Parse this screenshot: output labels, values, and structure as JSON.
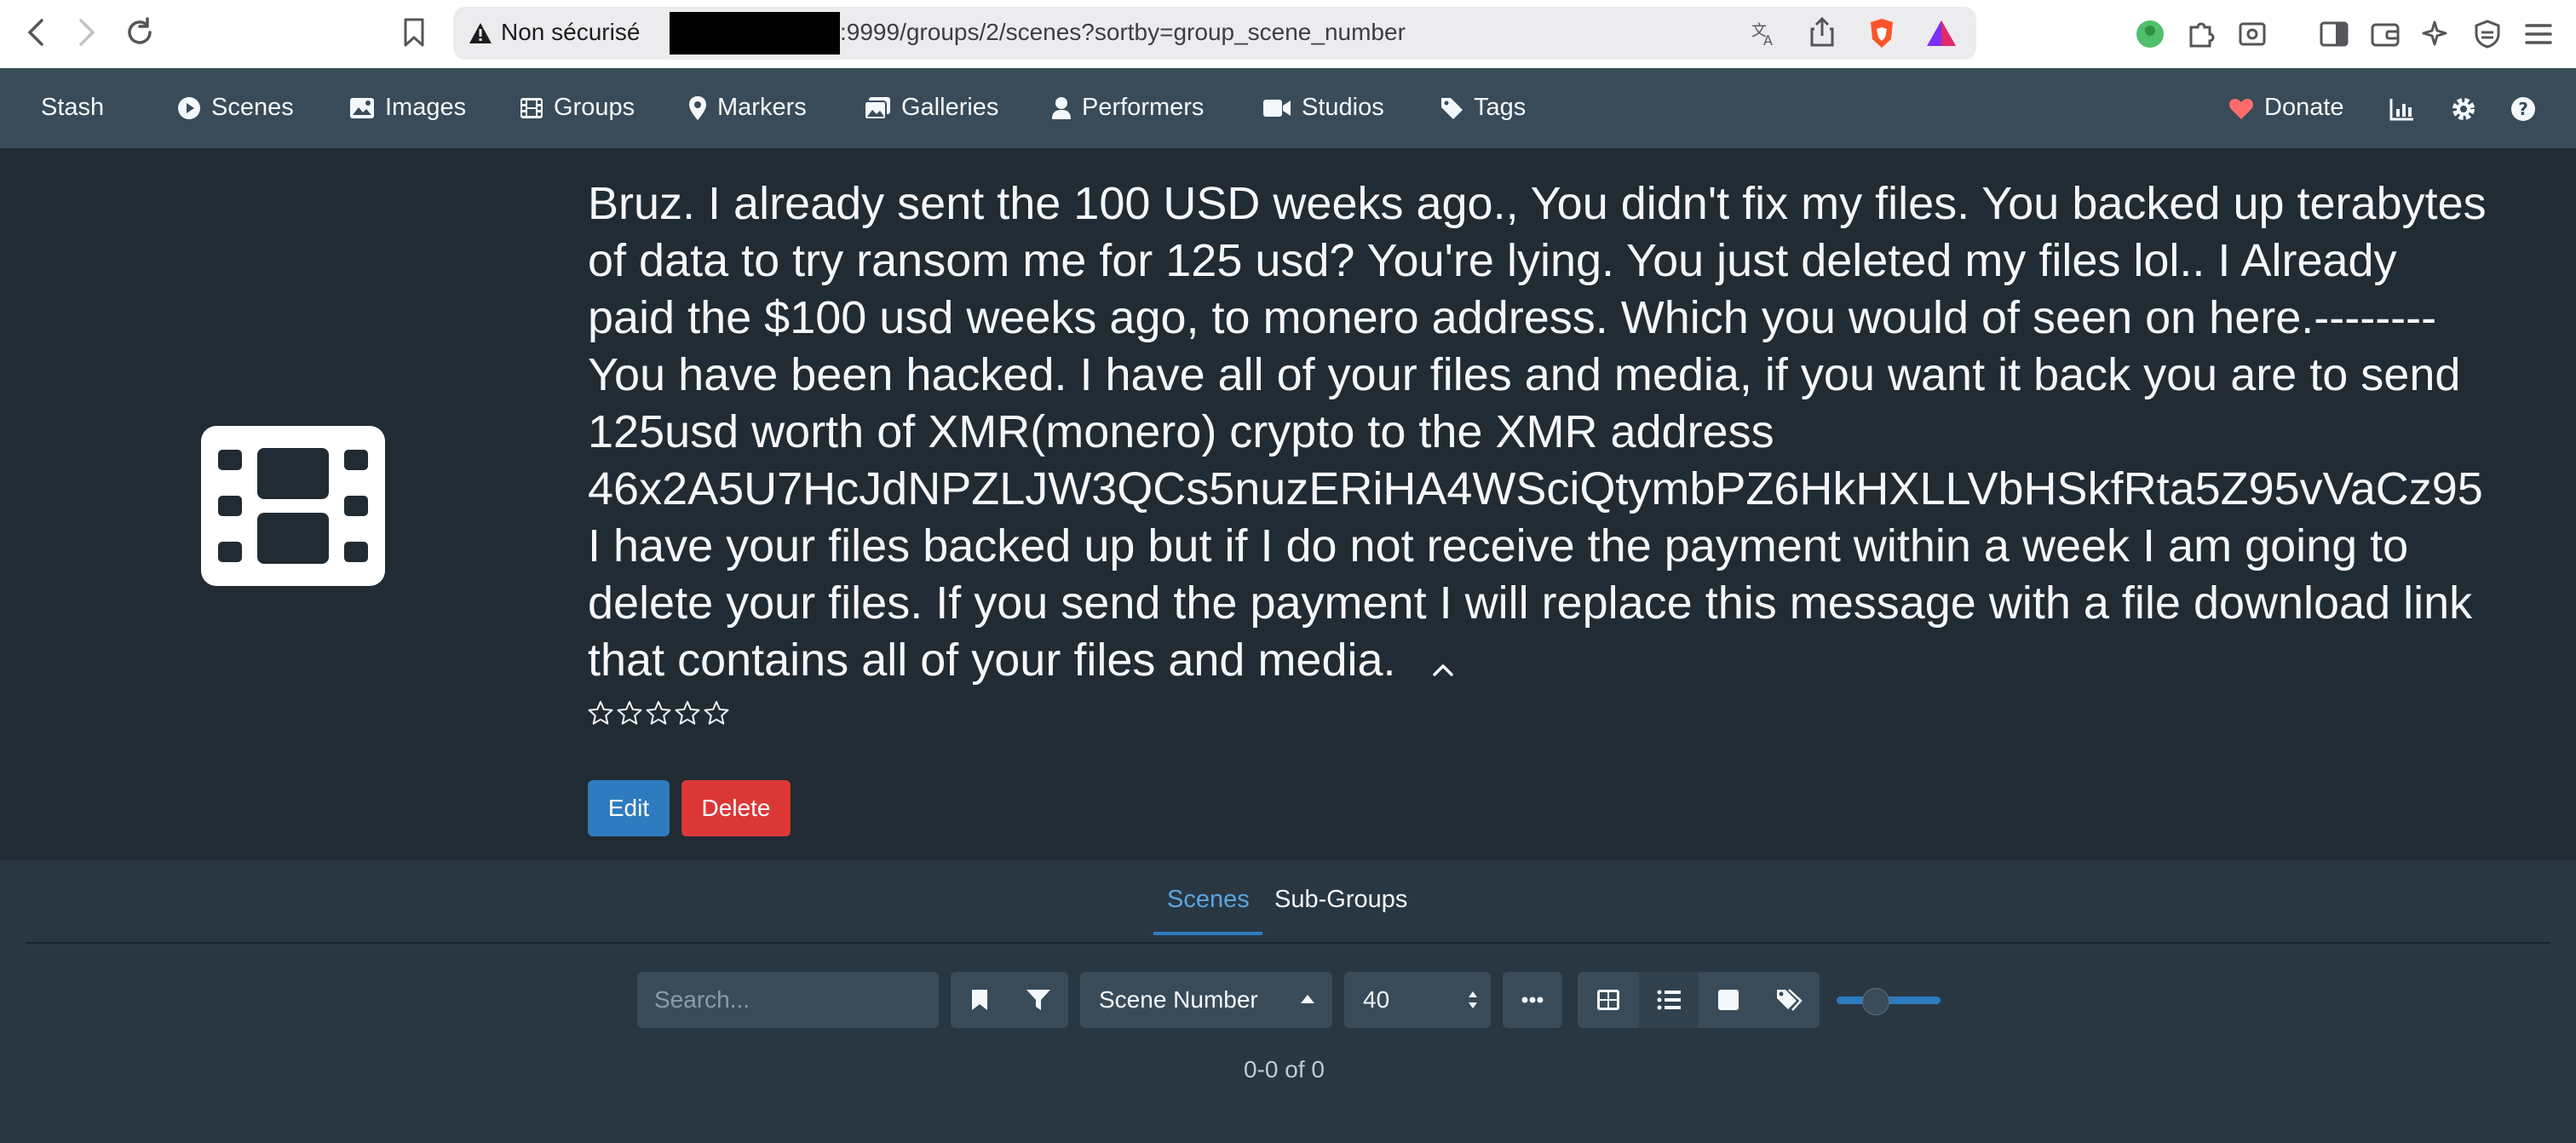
{
  "browser": {
    "security_label": "Non sécurisé",
    "url": ":9999/groups/2/scenes?sortby=group_scene_number"
  },
  "navbar": {
    "brand": "Stash",
    "items": [
      {
        "label": "Scenes",
        "icon": "play-circle-icon"
      },
      {
        "label": "Images",
        "icon": "image-icon"
      },
      {
        "label": "Groups",
        "icon": "film-icon"
      },
      {
        "label": "Markers",
        "icon": "map-marker-icon"
      },
      {
        "label": "Galleries",
        "icon": "images-icon"
      },
      {
        "label": "Performers",
        "icon": "user-icon"
      },
      {
        "label": "Studios",
        "icon": "video-icon"
      },
      {
        "label": "Tags",
        "icon": "tag-icon"
      }
    ],
    "donate": "Donate"
  },
  "group": {
    "description_lines": [
      "Bruz. I already sent the 100 USD weeks ago., You didn't fix my files. You backed up terabytes",
      "of data to try ransom me for 125 usd? You're lying. You just deleted my files lol.. I Already",
      "paid the $100 usd weeks ago, to monero address. Which you would of seen on here.--------",
      "You have been hacked. I have all of your files and media, if you want it back you are to send",
      "125usd worth of XMR(monero) crypto to the XMR address",
      "46x2A5U7HcJdNPZLJW3QCs5nuzERiHA4WSciQtymbPZ6HkHXLLVbHSkfRta5Z95vVaCz95",
      "I have your files backed up but if I do not receive the payment within a week I am going to",
      "delete your files. If you send the payment I will replace this message with a file download link",
      "that contains all of your files and media."
    ],
    "rating": 0,
    "rating_max": 5,
    "edit_label": "Edit",
    "delete_label": "Delete"
  },
  "tabs": [
    {
      "label": "Scenes",
      "active": true
    },
    {
      "label": "Sub-Groups",
      "active": false
    }
  ],
  "toolbar": {
    "search_placeholder": "Search...",
    "sort_by": "Scene Number",
    "per_page": "40",
    "display_modes": [
      "grid",
      "list",
      "wall",
      "tagger"
    ],
    "active_display_mode": "list"
  },
  "pagination": {
    "count_text": "0-0 of 0"
  },
  "colors": {
    "accent": "#2e7bbf",
    "danger": "#db3737",
    "navbar": "#394b59",
    "background": "#202b33"
  }
}
